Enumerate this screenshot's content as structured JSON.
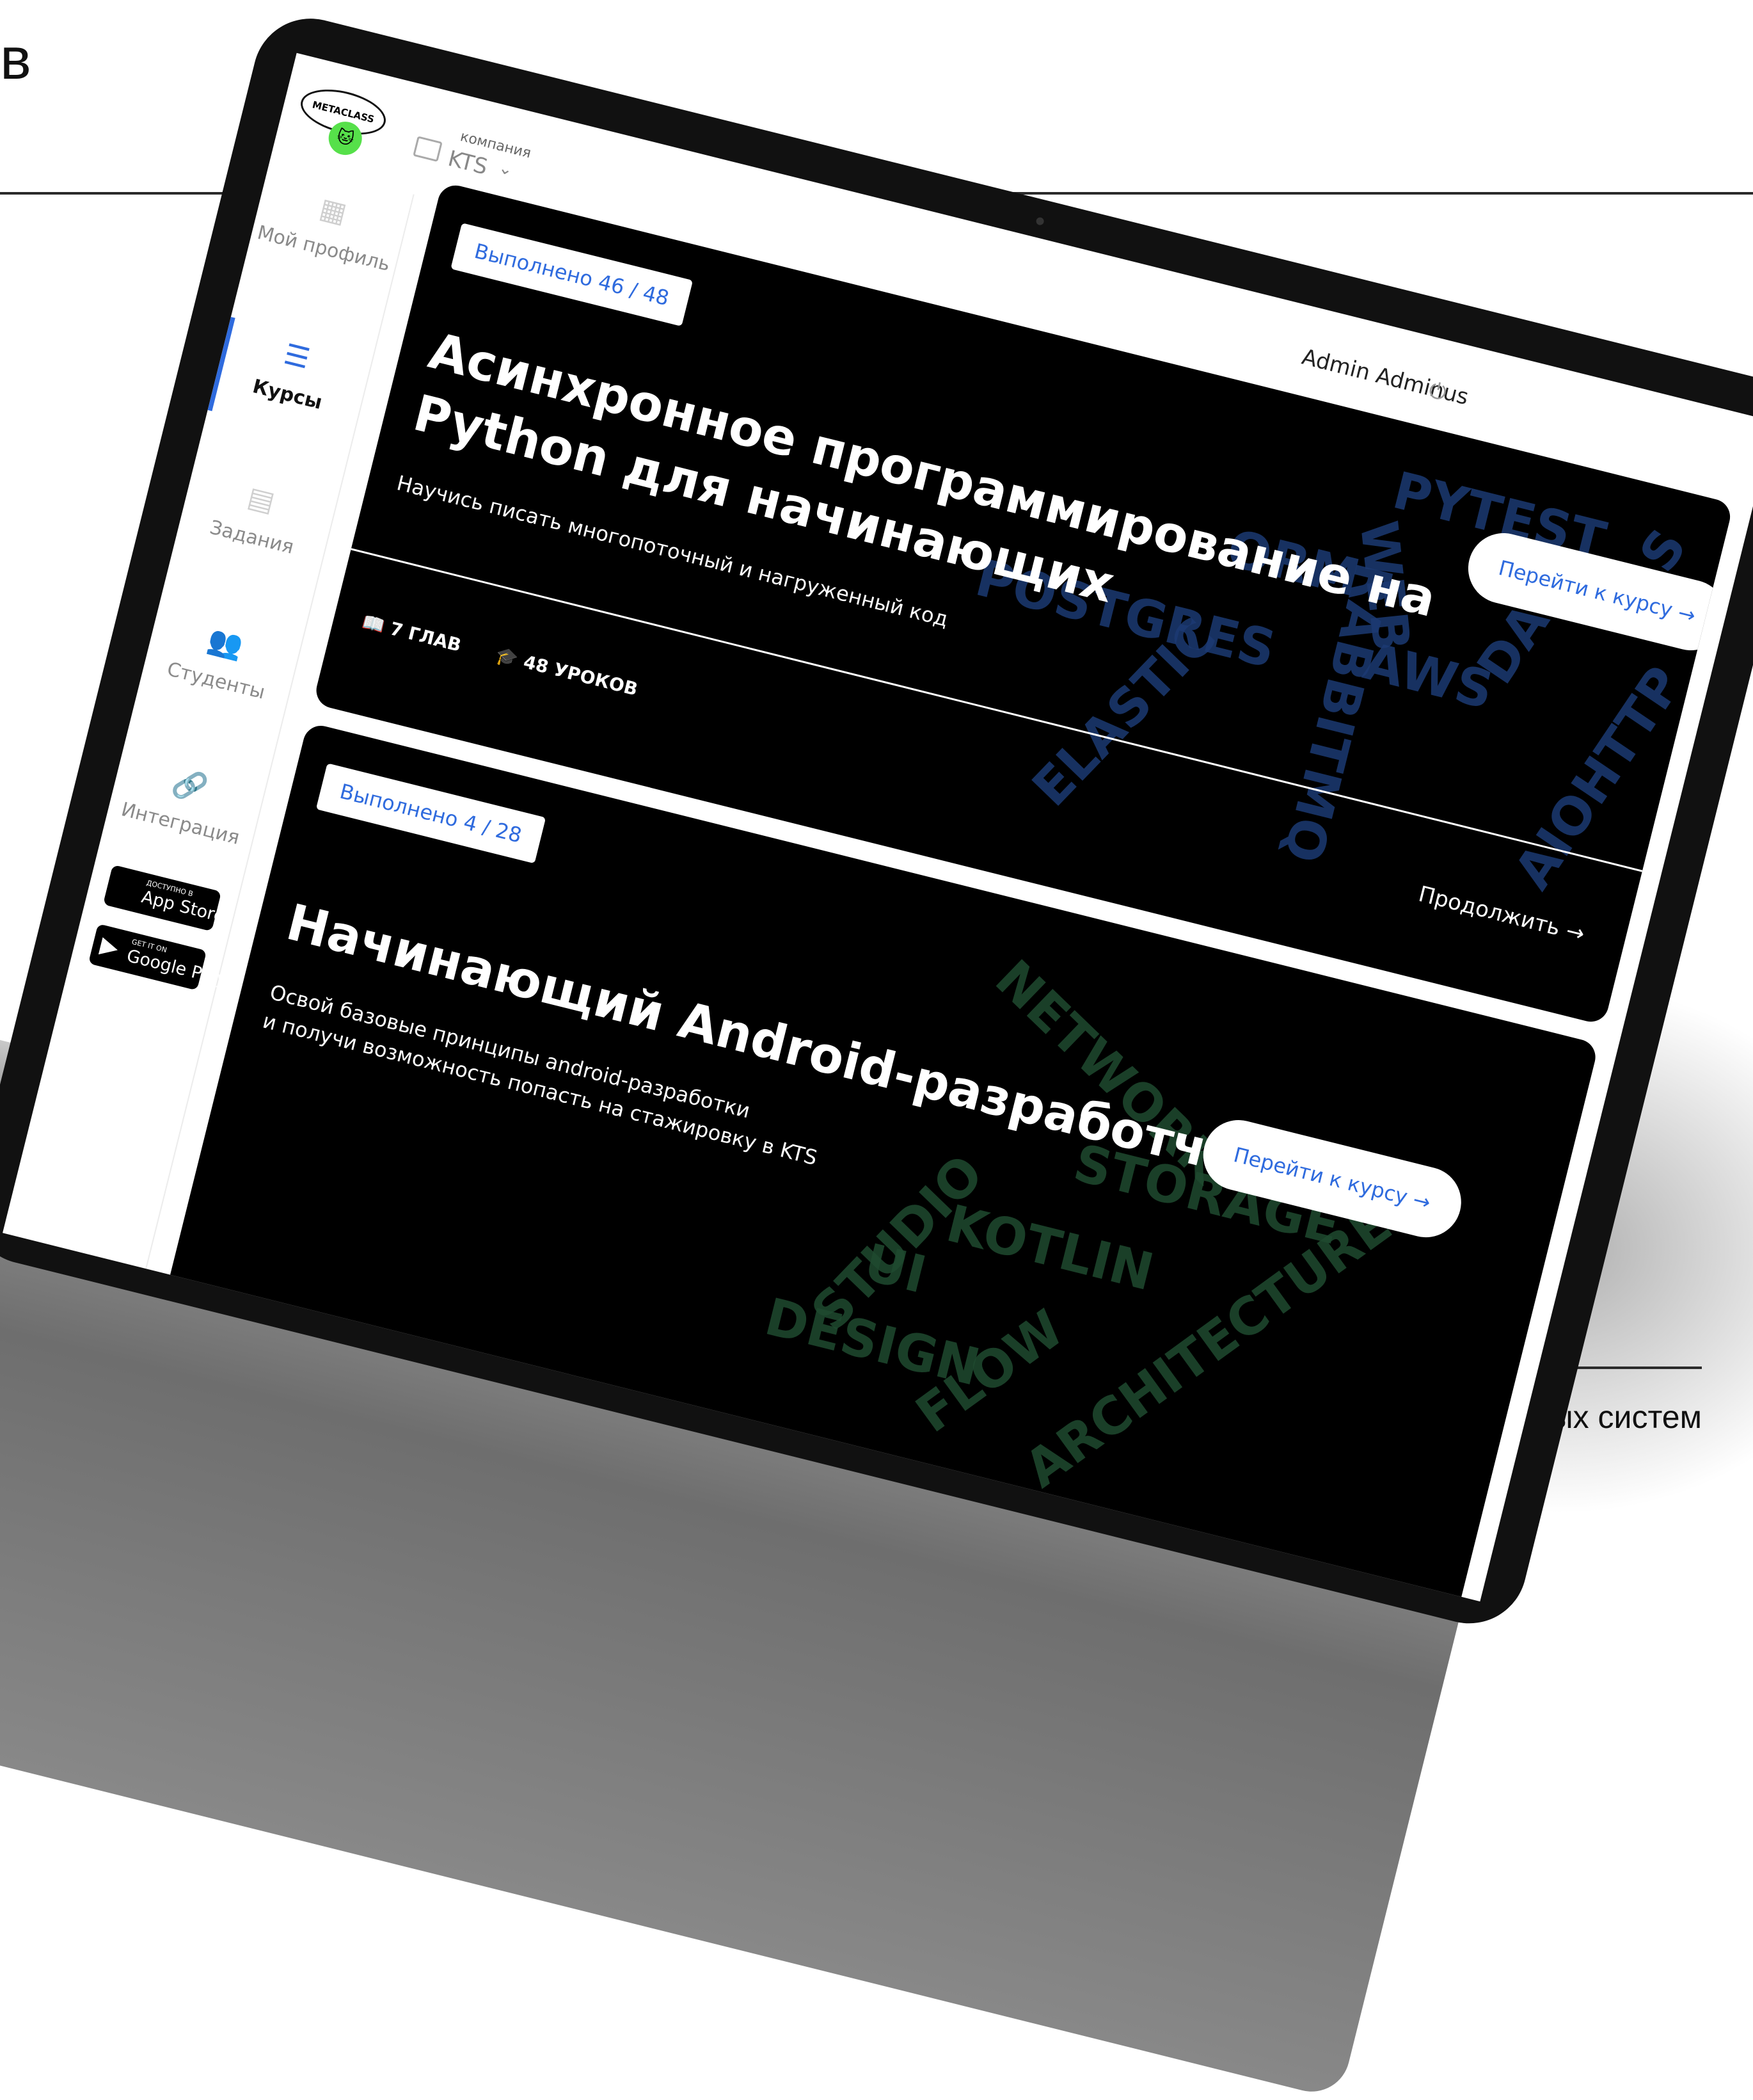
{
  "slide": {
    "corner_letter": "в",
    "footer_text": "ивных систем"
  },
  "header": {
    "logo_text": "METACLASS",
    "company_label": "компания",
    "company_value": "KTS",
    "admin_name": "Admin Adminus"
  },
  "sidebar": {
    "items": [
      {
        "label": "Мой профиль",
        "icon": "dashboard-icon"
      },
      {
        "label": "Курсы",
        "icon": "list-icon",
        "active": true
      },
      {
        "label": "Задания",
        "icon": "tasks-icon"
      },
      {
        "label": "Студенты",
        "icon": "students-icon"
      },
      {
        "label": "Интеграция",
        "icon": "link-icon"
      }
    ],
    "app_store": {
      "small": "ДОСТУПНО В",
      "big": "App Store"
    },
    "google_play": {
      "small": "GET IT ON",
      "big": "Google Play"
    }
  },
  "courses": [
    {
      "progress": "Выполнено 46 / 48",
      "title": "Асинхронное программирование на Python для начинающих",
      "subtitle": "Научись писать многопоточный и нагруженный код",
      "button": "Перейти к курсу",
      "chapters": "7 ГЛАВ",
      "lessons": "48 УРОКОВ",
      "continue": "Продолжить",
      "tags": [
        "PYTEST",
        "WEB",
        "ORM",
        "POSTGRES",
        "ELASTIC",
        "RABBITMQ",
        "AWS",
        "DATA",
        "AIOHTTP",
        "AS"
      ]
    },
    {
      "progress": "Выполнено 4 / 28",
      "title": "Начинающий Android-разработчик",
      "subtitle_lines": [
        "Освой базовые принципы android-разработки",
        "и получи возможность попасть на стажировку в KTS"
      ],
      "button": "Перейти к курсу",
      "tags": [
        "NETWORK",
        "STORAGE",
        "KOTLIN",
        "STUDIO",
        "UI",
        "DESIGN",
        "FLOW",
        "ARCHITECTURE"
      ]
    }
  ],
  "colors": {
    "accent": "#2f6bde",
    "tag_blue": "#1c3a73",
    "tag_green": "#1f4a30"
  }
}
